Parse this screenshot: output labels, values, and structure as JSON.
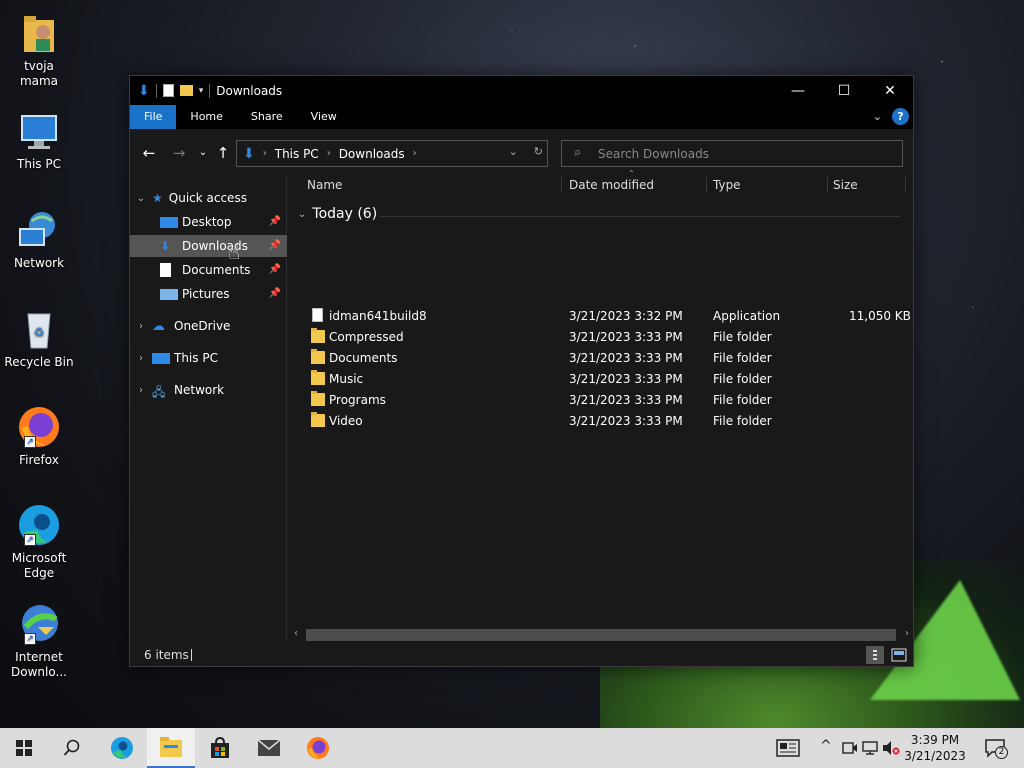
{
  "desktop": {
    "icons": [
      {
        "label": "tvoja mama"
      },
      {
        "label": "This PC"
      },
      {
        "label": "Network"
      },
      {
        "label": "Recycle Bin"
      },
      {
        "label": "Firefox"
      },
      {
        "label": "Microsoft Edge"
      },
      {
        "label": "Internet Downlo..."
      }
    ]
  },
  "window": {
    "title": "Downloads",
    "ribbon_tabs": [
      "File",
      "Home",
      "Share",
      "View"
    ],
    "help_label": "?",
    "address": {
      "crumbs": [
        "This PC",
        "Downloads"
      ]
    },
    "search": {
      "placeholder": "Search Downloads"
    },
    "nav": {
      "quick_access": "Quick access",
      "items": [
        "Desktop",
        "Downloads",
        "Documents",
        "Pictures"
      ],
      "onedrive": "OneDrive",
      "thispc": "This PC",
      "network": "Network"
    },
    "columns": [
      "Name",
      "Date modified",
      "Type",
      "Size"
    ],
    "group_label": "Today (6)",
    "files": [
      {
        "name": "idman641build8",
        "date": "3/21/2023 3:32 PM",
        "type": "Application",
        "size": "11,050 KB",
        "kind": "app"
      },
      {
        "name": "Compressed",
        "date": "3/21/2023 3:33 PM",
        "type": "File folder",
        "size": "",
        "kind": "folder"
      },
      {
        "name": "Documents",
        "date": "3/21/2023 3:33 PM",
        "type": "File folder",
        "size": "",
        "kind": "folder"
      },
      {
        "name": "Music",
        "date": "3/21/2023 3:33 PM",
        "type": "File folder",
        "size": "",
        "kind": "folder"
      },
      {
        "name": "Programs",
        "date": "3/21/2023 3:33 PM",
        "type": "File folder",
        "size": "",
        "kind": "folder"
      },
      {
        "name": "Video",
        "date": "3/21/2023 3:33 PM",
        "type": "File folder",
        "size": "",
        "kind": "folder"
      }
    ],
    "status": {
      "items": "6 items"
    }
  },
  "taskbar": {
    "time": "3:39 PM",
    "date": "3/21/2023",
    "notif_count": "2"
  },
  "colors": {
    "accent": "#1a73c8",
    "folder": "#f2c94c"
  }
}
